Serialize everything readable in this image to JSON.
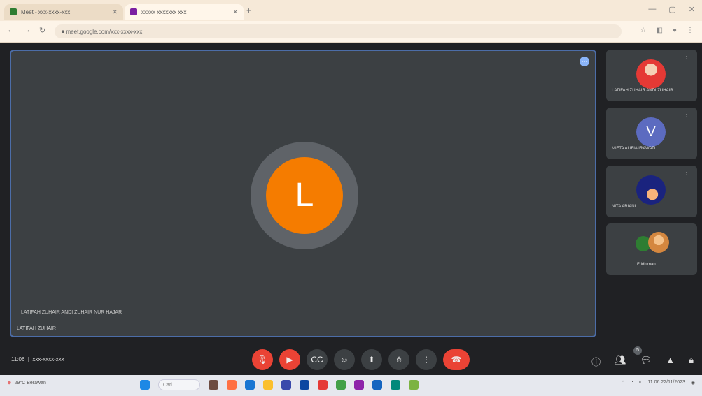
{
  "browser": {
    "tab1": "Meet - xxx-xxxx-xxx",
    "tab2": "xxxxx xxxxxxx xxx",
    "url": "meet.google.com/xxx-xxxx-xxx"
  },
  "meeting": {
    "main_initial": "L",
    "main_caption": "LATIFAH ZUHAIR ANDI ZUHAIR NUR HAJAR",
    "main_name": "LATIFAH ZUHAIR",
    "time": "11:06",
    "code": "xxx-xxxx-xxx",
    "people_count": "5",
    "participants": [
      {
        "name": "LATIFAH ZUHAIR ANDI ZUHAIR",
        "color": "#e53935"
      },
      {
        "name": "MIFTA ALIFIA IRAWATI",
        "initial": "V",
        "color": "#5c6bc0"
      },
      {
        "name": "NITA ARIANI",
        "color": "#1a237e"
      },
      {
        "name": "Fridhiman",
        "color": "#d4873f"
      }
    ]
  },
  "taskbar": {
    "weather": "29°C Berawan",
    "search": "Cari",
    "clock": "11:06",
    "date": "22/11/2023"
  }
}
